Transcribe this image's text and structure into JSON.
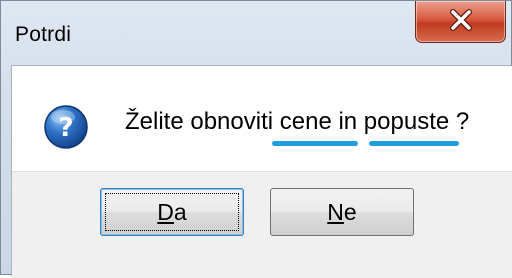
{
  "window": {
    "title": "Potrdi"
  },
  "dialog": {
    "icon": "question-icon",
    "message": "Želite obnoviti cene in popuste ?",
    "highlighted_words": [
      "cene",
      "popuste"
    ],
    "highlight_color": "#1ea0e0"
  },
  "buttons": {
    "yes": {
      "mnemonic": "D",
      "rest": "a",
      "label": "Da"
    },
    "no": {
      "mnemonic": "N",
      "rest": "e",
      "label": "Ne"
    }
  },
  "colors": {
    "close_button": "#c8432a",
    "default_button_border": "#3c7fb1"
  }
}
